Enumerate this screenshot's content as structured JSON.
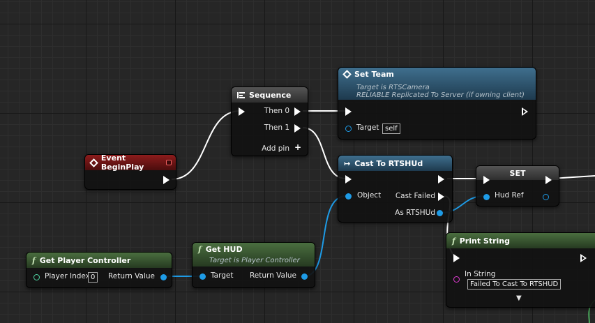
{
  "nodes": {
    "event_begin_play": {
      "title": "Event BeginPlay"
    },
    "sequence": {
      "title": "Sequence",
      "then0": "Then 0",
      "then1": "Then 1",
      "add_pin": "Add pin"
    },
    "set_team": {
      "title": "Set Team",
      "sub1": "Target is RTSCamera",
      "sub2": "RELIABLE Replicated To Server (if owning client)",
      "target_label": "Target",
      "target_value": "self"
    },
    "cast": {
      "title": "Cast To RTSHUd",
      "object": "Object",
      "cast_failed": "Cast Failed",
      "as": "As RTSHUd"
    },
    "set": {
      "title": "SET",
      "hud_ref": "Hud Ref"
    },
    "get_player_controller": {
      "title": "Get Player Controller",
      "player_index": "Player Index",
      "player_index_value": "0",
      "return_value": "Return Value"
    },
    "get_hud": {
      "title": "Get HUD",
      "sub": "Target is Player Controller",
      "target": "Target",
      "return_value": "Return Value"
    },
    "print_string": {
      "title": "Print String",
      "in_string": "In String",
      "in_string_value": "Failed To Cast To RTSHUD",
      "expand": "▼"
    }
  },
  "colors": {
    "exec_wire": "#ffffff",
    "object_wire": "#1e9be6",
    "string_pin": "#e13ad3",
    "event_header": "#8d1c1c",
    "function_header": "#4a6e3f",
    "replicated_header": "#3f6f8e"
  }
}
